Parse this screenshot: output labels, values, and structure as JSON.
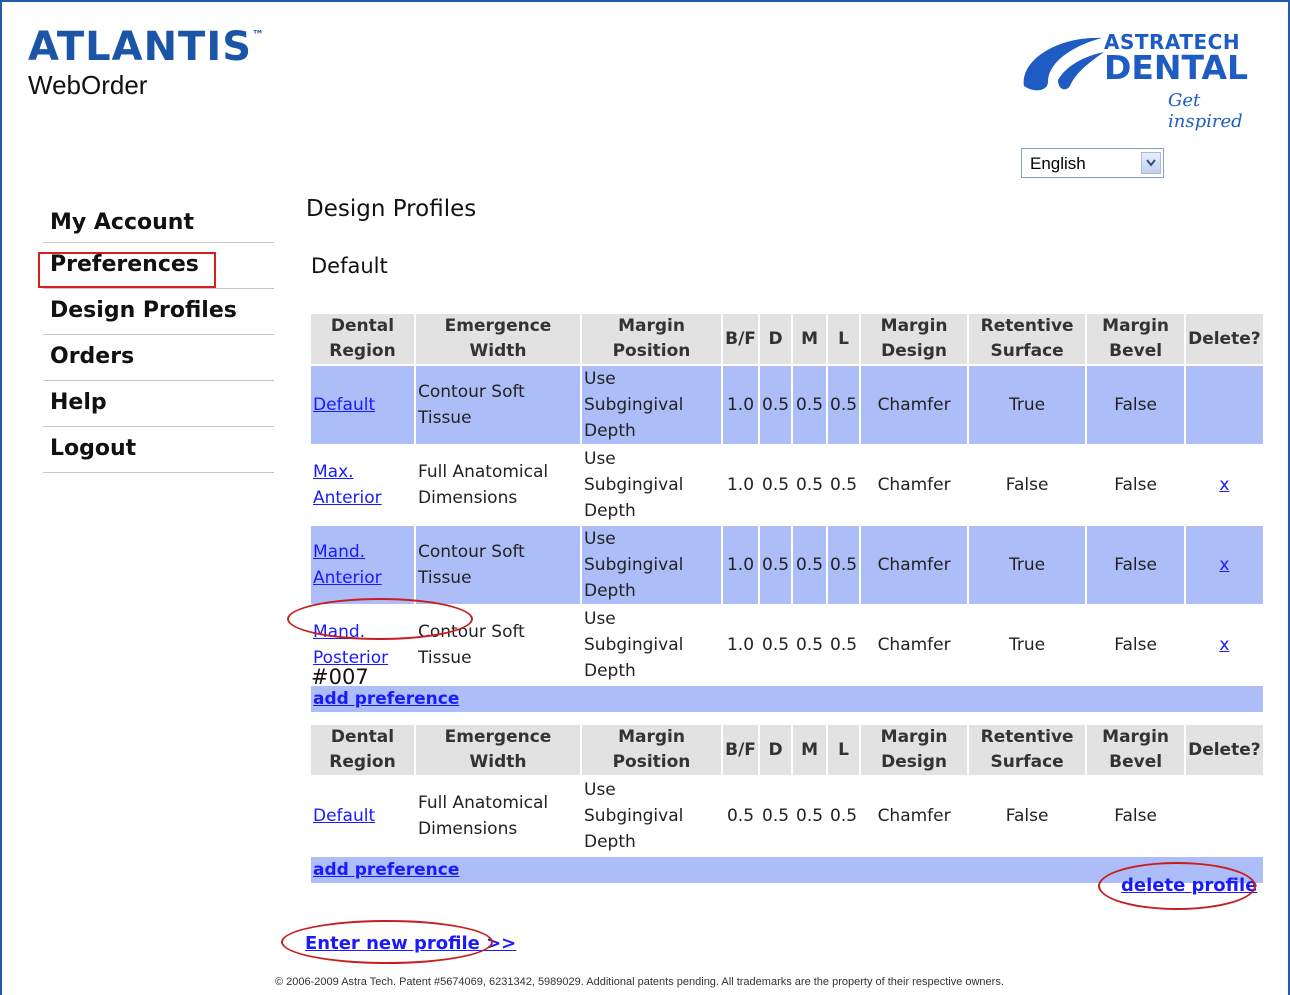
{
  "brand": {
    "logo_main": "ATLANTIS",
    "logo_tm": "™",
    "logo_sub": "WebOrder",
    "partner_line1": "ASTRATECH",
    "partner_line2": "DENTAL",
    "partner_tagline": "Get inspired"
  },
  "language": {
    "selected": "English"
  },
  "nav": {
    "items": [
      "My Account",
      "Preferences",
      "Design Profiles",
      "Orders",
      "Help",
      "Logout"
    ],
    "highlighted": "Preferences"
  },
  "page": {
    "title": "Design Profiles"
  },
  "table_headers": {
    "region": [
      "Dental",
      "Region"
    ],
    "emergence": [
      "Emergence",
      "Width"
    ],
    "margin_position": [
      "Margin",
      "Position"
    ],
    "bf": "B/F",
    "d": "D",
    "m": "M",
    "l": "L",
    "margin_design": [
      "Margin",
      "Design"
    ],
    "retentive": [
      "Retentive",
      "Surface"
    ],
    "bevel": [
      "Margin",
      "Bevel"
    ],
    "delete": "Delete?"
  },
  "profiles": [
    {
      "name": "Default",
      "rows": [
        {
          "region": [
            "Default"
          ],
          "emergence": [
            "Contour Soft",
            "Tissue"
          ],
          "margin_position": [
            "Use Subgingival",
            "Depth"
          ],
          "bf": "1.0",
          "d": "0.5",
          "m": "0.5",
          "l": "0.5",
          "margin_design": "Chamfer",
          "retentive": "True",
          "bevel": "False",
          "delete": ""
        },
        {
          "region": [
            "Max.",
            "Anterior"
          ],
          "emergence": [
            "Full Anatomical",
            "Dimensions"
          ],
          "margin_position": [
            "Use Subgingival",
            "Depth"
          ],
          "bf": "1.0",
          "d": "0.5",
          "m": "0.5",
          "l": "0.5",
          "margin_design": "Chamfer",
          "retentive": "False",
          "bevel": "False",
          "delete": "x"
        },
        {
          "region": [
            "Mand.",
            "Anterior"
          ],
          "emergence": [
            "Contour Soft",
            "Tissue"
          ],
          "margin_position": [
            "Use Subgingival",
            "Depth"
          ],
          "bf": "1.0",
          "d": "0.5",
          "m": "0.5",
          "l": "0.5",
          "margin_design": "Chamfer",
          "retentive": "True",
          "bevel": "False",
          "delete": "x"
        },
        {
          "region": [
            "Mand.",
            "Posterior"
          ],
          "emergence": [
            "Contour Soft",
            "Tissue"
          ],
          "margin_position": [
            "Use Subgingival",
            "Depth"
          ],
          "bf": "1.0",
          "d": "0.5",
          "m": "0.5",
          "l": "0.5",
          "margin_design": "Chamfer",
          "retentive": "True",
          "bevel": "False",
          "delete": "x"
        }
      ],
      "add_label": "add preference"
    },
    {
      "name": "#007",
      "rows": [
        {
          "region": [
            "Default"
          ],
          "emergence": [
            "Full Anatomical",
            "Dimensions"
          ],
          "margin_position": [
            "Use Subgingival",
            "Depth"
          ],
          "bf": "0.5",
          "d": "0.5",
          "m": "0.5",
          "l": "0.5",
          "margin_design": "Chamfer",
          "retentive": "False",
          "bevel": "False",
          "delete": ""
        }
      ],
      "add_label": "add preference"
    }
  ],
  "actions": {
    "delete_profile": "delete profile",
    "enter_new_profile": "Enter new profile >>"
  },
  "footer": "© 2006-2009 Astra Tech.  Patent #5674069, 6231342, 5989029. Additional patents pending. All trademarks are the property of their respective owners.",
  "colors": {
    "row_highlight": "#adbdf7",
    "header_bg": "#e2e2e2",
    "link": "#1a1aff",
    "annotation": "#c81e1e",
    "brand_blue": "#1e5cc4"
  }
}
